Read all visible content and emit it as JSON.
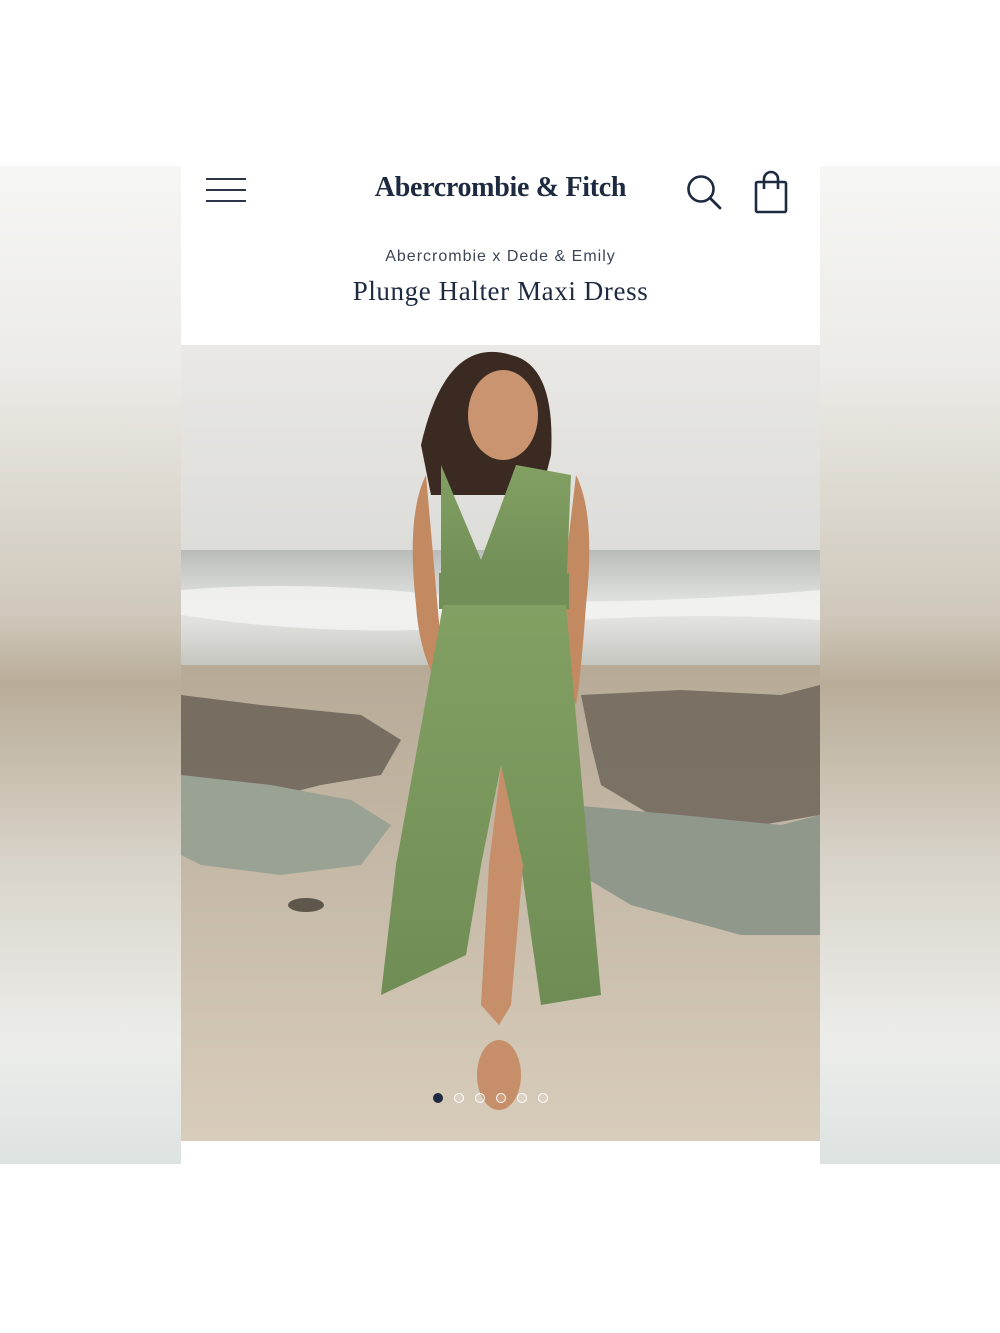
{
  "header": {
    "brand": "Abercrombie & Fitch",
    "menu_icon": "hamburger-menu-icon",
    "search_icon": "search-icon",
    "bag_icon": "shopping-bag-icon"
  },
  "product": {
    "collaboration": "Abercrombie x Dede & Emily",
    "title": "Plunge Halter Maxi Dress",
    "dress_color": "#7d9a5e"
  },
  "gallery": {
    "image_count": 6,
    "active_index": 0
  },
  "colors": {
    "navy": "#1e2a40"
  }
}
